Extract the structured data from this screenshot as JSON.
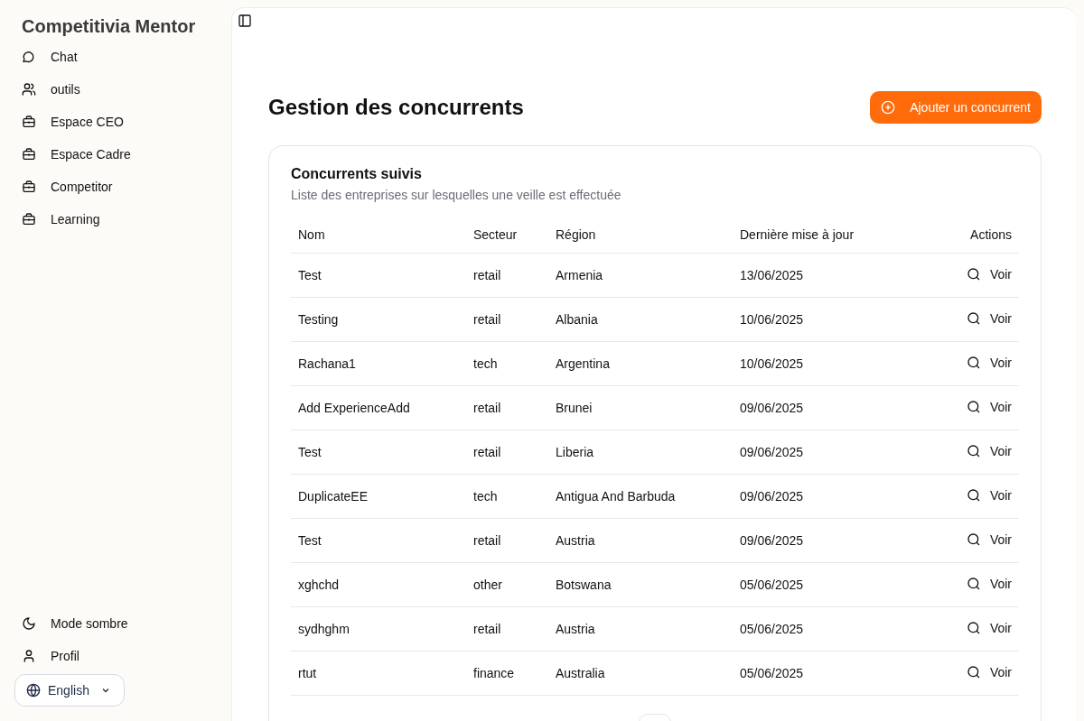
{
  "sidebar": {
    "title": "Competitivia Mentor",
    "items": [
      {
        "label": "Chat",
        "kind": "chat"
      },
      {
        "label": "outils",
        "kind": "tools"
      },
      {
        "label": "Espace CEO",
        "kind": "space"
      },
      {
        "label": "Espace Cadre",
        "kind": "space"
      },
      {
        "label": "Competitor",
        "kind": "space"
      },
      {
        "label": "Learning",
        "kind": "space"
      }
    ],
    "bottom_items": [
      {
        "label": "Mode sombre",
        "kind": "theme"
      },
      {
        "label": "Profil",
        "kind": "profile"
      }
    ],
    "language": "English"
  },
  "page": {
    "title": "Gestion des concurrents",
    "add_button": "Ajouter un concurrent"
  },
  "card": {
    "title": "Concurrents suivis",
    "subtitle": "Liste des entreprises sur lesquelles une veille est effectuée",
    "columns": [
      "Nom",
      "Secteur",
      "Région",
      "Dernière mise à jour",
      "Actions"
    ],
    "rows": [
      {
        "name": "Test",
        "sector": "retail",
        "region": "Armenia",
        "updated": "13/06/2025",
        "action": "Voir"
      },
      {
        "name": "Testing",
        "sector": "retail",
        "region": "Albania",
        "updated": "10/06/2025",
        "action": "Voir"
      },
      {
        "name": "Rachana1",
        "sector": "tech",
        "region": "Argentina",
        "updated": "10/06/2025",
        "action": "Voir"
      },
      {
        "name": "Add ExperienceAdd",
        "sector": "retail",
        "region": "Brunei",
        "updated": "09/06/2025",
        "action": "Voir"
      },
      {
        "name": "Test",
        "sector": "retail",
        "region": "Liberia",
        "updated": "09/06/2025",
        "action": "Voir"
      },
      {
        "name": "DuplicateEE",
        "sector": "tech",
        "region": "Antigua And Barbuda",
        "updated": "09/06/2025",
        "action": "Voir"
      },
      {
        "name": "Test",
        "sector": "retail",
        "region": "Austria",
        "updated": "09/06/2025",
        "action": "Voir"
      },
      {
        "name": "xghchd",
        "sector": "other",
        "region": "Botswana",
        "updated": "05/06/2025",
        "action": "Voir"
      },
      {
        "name": "sydhghm",
        "sector": "retail",
        "region": "Austria",
        "updated": "05/06/2025",
        "action": "Voir"
      },
      {
        "name": "rtut",
        "sector": "finance",
        "region": "Australia",
        "updated": "05/06/2025",
        "action": "Voir"
      }
    ]
  }
}
